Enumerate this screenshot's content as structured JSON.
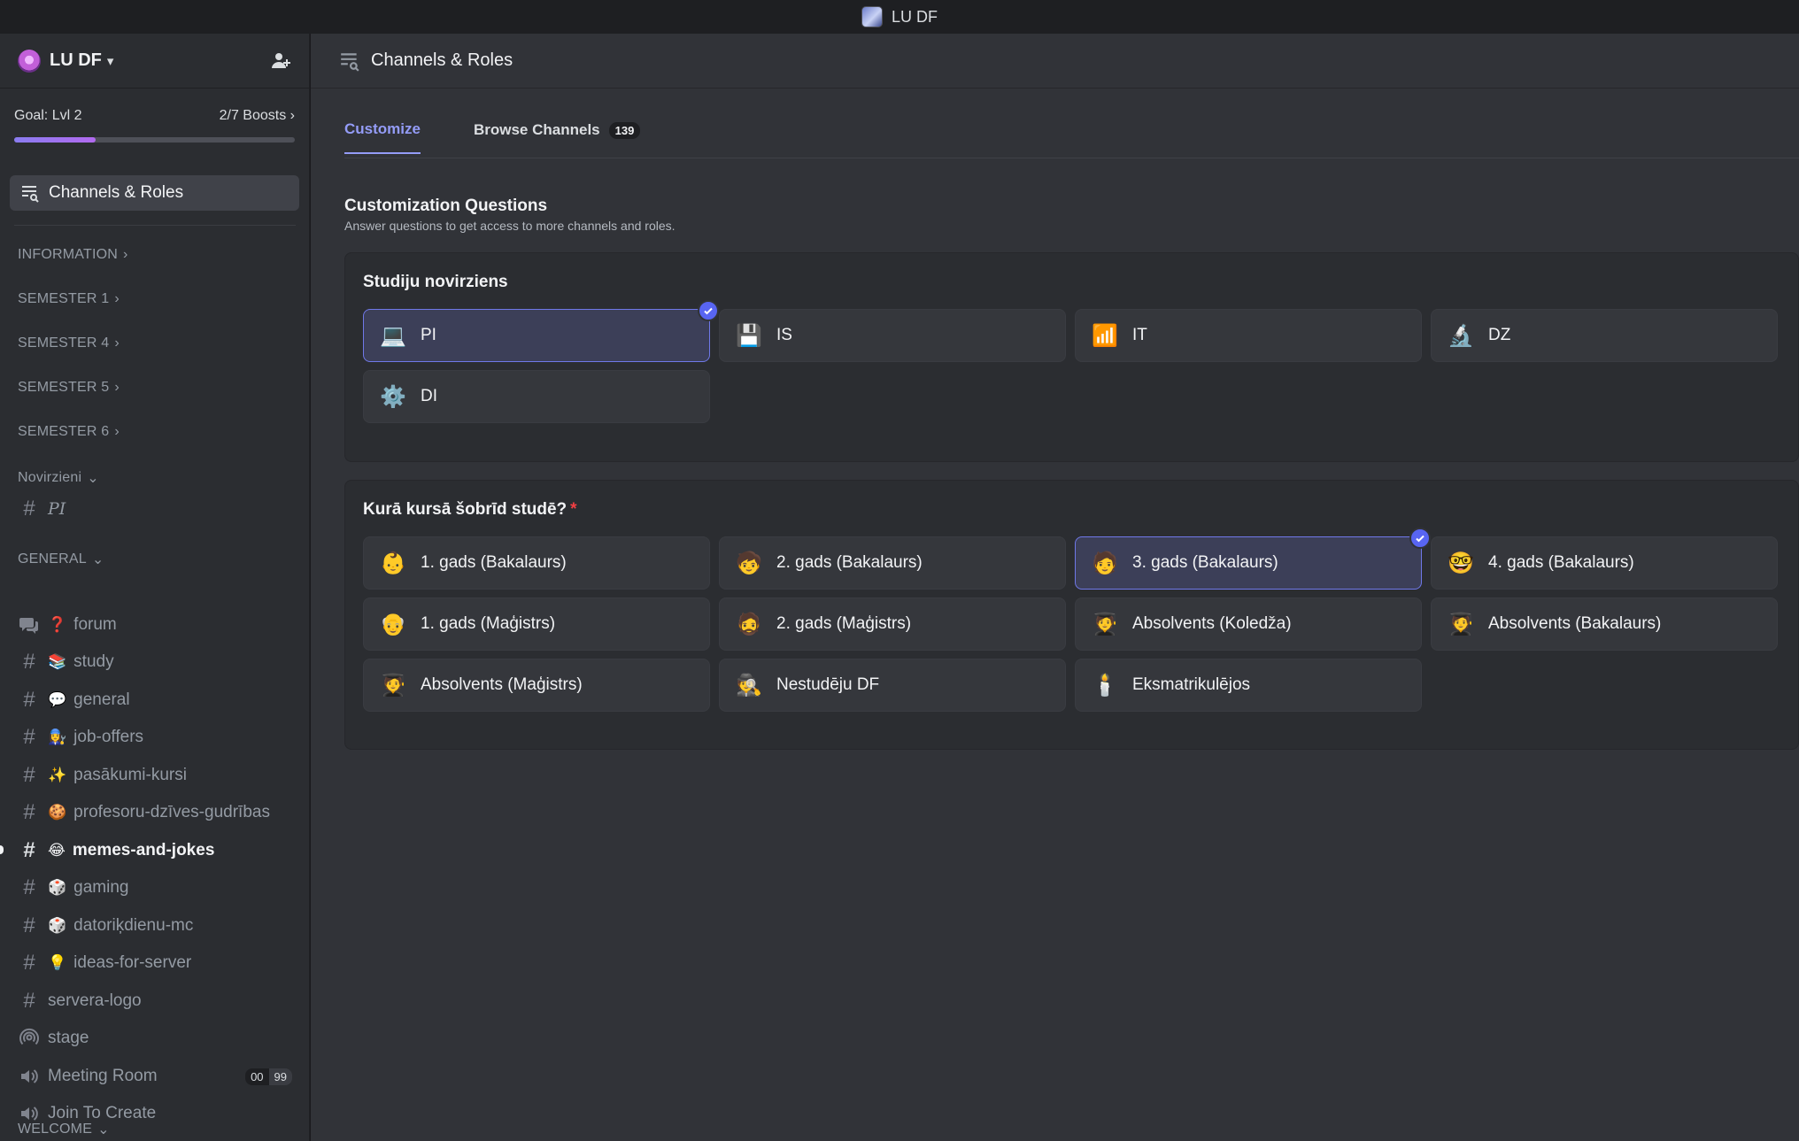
{
  "window": {
    "title": "LU DF"
  },
  "server": {
    "name": "LU DF",
    "chevron": "▾"
  },
  "boost": {
    "goal": "Goal: Lvl 2",
    "count": "2/7 Boosts",
    "progress": 0.29
  },
  "nav": {
    "channels_roles": "Channels & Roles"
  },
  "categories": {
    "information": "INFORMATION",
    "semester1": "SEMESTER 1",
    "semester4": "SEMESTER 4",
    "semester5": "SEMESTER 5",
    "semester6": "SEMESTER 6",
    "novirzieni": "Novirzieni",
    "general": "GENERAL",
    "welcome": "WELCOME"
  },
  "channels": {
    "pi": "PI",
    "forum": {
      "emoji": "❓",
      "name": "forum"
    },
    "study": {
      "emoji": "📚",
      "name": "study"
    },
    "general": {
      "emoji": "💬",
      "name": "general"
    },
    "job_offers": {
      "emoji": "👩‍🔧",
      "name": "job-offers"
    },
    "pasakumi": {
      "emoji": "✨",
      "name": "pasākumi-kursi"
    },
    "profesoru": {
      "emoji": "🍪",
      "name": "profesoru-dzīves-gudrības"
    },
    "memes": {
      "emoji": "😂",
      "name": "memes-and-jokes"
    },
    "gaming": {
      "emoji": "🎲",
      "name": "gaming"
    },
    "datoriku": {
      "emoji": "🎲",
      "name": "datoriķdienu-mc"
    },
    "ideas": {
      "emoji": "💡",
      "name": "ideas-for-server"
    },
    "servera_logo": "servera-logo",
    "stage": "stage",
    "meeting": {
      "name": "Meeting Room",
      "badge_left": "00",
      "badge_right": "99"
    },
    "join": "Join To Create"
  },
  "main": {
    "header": "Channels & Roles",
    "tabs": {
      "customize": "Customize",
      "browse": "Browse Channels",
      "browse_count": "139"
    },
    "section_title": "Customization Questions",
    "section_sub": "Answer questions to get access to more channels and roles."
  },
  "q1": {
    "title": "Studiju novirziens",
    "options": [
      {
        "label": "PI",
        "icon": "💻",
        "selected": true
      },
      {
        "label": "IS",
        "icon": "💾",
        "selected": false
      },
      {
        "label": "IT",
        "icon": "📶",
        "selected": false
      },
      {
        "label": "DZ",
        "icon": "🔬",
        "selected": false
      },
      {
        "label": "DI",
        "icon": "⚙️",
        "selected": false
      }
    ]
  },
  "q2": {
    "title": "Kurā kursā šobrīd studē?",
    "required_mark": "*",
    "options": [
      {
        "label": "1. gads (Bakalaurs)",
        "icon": "👶",
        "selected": false
      },
      {
        "label": "2. gads (Bakalaurs)",
        "icon": "🧒",
        "selected": false
      },
      {
        "label": "3. gads (Bakalaurs)",
        "icon": "🧑",
        "selected": true
      },
      {
        "label": "4. gads (Bakalaurs)",
        "icon": "🤓",
        "selected": false
      },
      {
        "label": "1. gads (Maģistrs)",
        "icon": "👴",
        "selected": false
      },
      {
        "label": "2. gads (Maģistrs)",
        "icon": "🧔",
        "selected": false
      },
      {
        "label": "Absolvents (Koledža)",
        "icon": "🧑‍🎓",
        "selected": false
      },
      {
        "label": "Absolvents (Bakalaurs)",
        "icon": "🧑‍🎓",
        "selected": false
      },
      {
        "label": "Absolvents (Maģistrs)",
        "icon": "🧑‍🎓",
        "selected": false
      },
      {
        "label": "Nestudēju DF",
        "icon": "🕵️",
        "selected": false
      },
      {
        "label": "Eksmatrikulējos",
        "icon": "🕯️",
        "selected": false
      }
    ]
  },
  "colors": {
    "accent": "#5865f2",
    "tab_active": "#949cf7",
    "required": "#f23f43"
  }
}
